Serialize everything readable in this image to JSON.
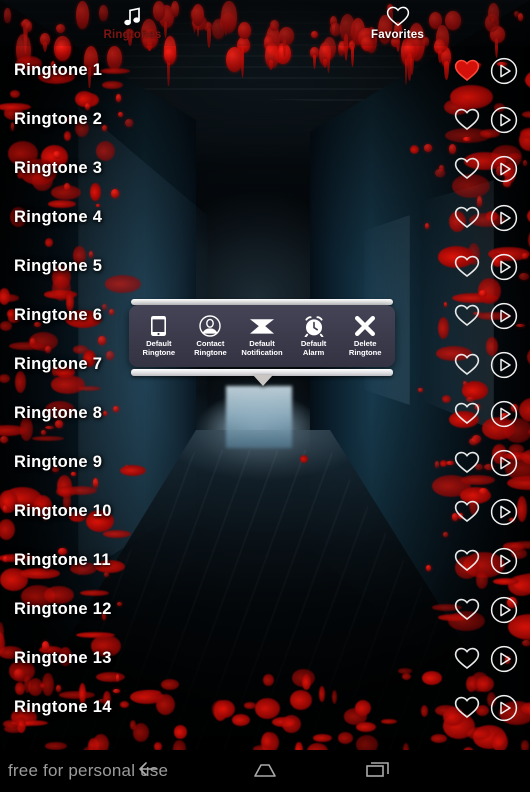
{
  "app": {
    "theme_accent": "#b80c08",
    "popup_bg": "#3b3a4b",
    "text_color": "#ffffff"
  },
  "tabs": [
    {
      "label": "Ringtones",
      "icon": "music-note-icon",
      "state": "inactive"
    },
    {
      "label": "Favorites",
      "icon": "heart-outline-icon",
      "state": "active"
    }
  ],
  "list": {
    "rows": [
      {
        "label": "Ringtone 1",
        "favorite": true,
        "heart_icon": "heart-filled-icon",
        "play_icon": "play-circle-icon"
      },
      {
        "label": "Ringtone 2",
        "favorite": false,
        "heart_icon": "heart-outline-icon",
        "play_icon": "play-circle-icon"
      },
      {
        "label": "Ringtone 3",
        "favorite": false,
        "heart_icon": "heart-outline-icon",
        "play_icon": "play-circle-icon"
      },
      {
        "label": "Ringtone 4",
        "favorite": false,
        "heart_icon": "heart-outline-icon",
        "play_icon": "play-circle-icon"
      },
      {
        "label": "Ringtone 5",
        "favorite": false,
        "heart_icon": "heart-outline-icon",
        "play_icon": "play-circle-icon"
      },
      {
        "label": "Ringtone 6",
        "favorite": false,
        "heart_icon": "heart-outline-icon",
        "play_icon": "play-circle-icon"
      },
      {
        "label": "Ringtone 7",
        "favorite": false,
        "heart_icon": "heart-outline-icon",
        "play_icon": "play-circle-icon"
      },
      {
        "label": "Ringtone 8",
        "favorite": false,
        "heart_icon": "heart-outline-icon",
        "play_icon": "play-circle-icon"
      },
      {
        "label": "Ringtone 9",
        "favorite": false,
        "heart_icon": "heart-outline-icon",
        "play_icon": "play-circle-icon"
      },
      {
        "label": "Ringtone 10",
        "favorite": false,
        "heart_icon": "heart-outline-icon",
        "play_icon": "play-circle-icon"
      },
      {
        "label": "Ringtone 11",
        "favorite": false,
        "heart_icon": "heart-outline-icon",
        "play_icon": "play-circle-icon"
      },
      {
        "label": "Ringtone 12",
        "favorite": false,
        "heart_icon": "heart-outline-icon",
        "play_icon": "play-circle-icon"
      },
      {
        "label": "Ringtone 13",
        "favorite": false,
        "heart_icon": "heart-outline-icon",
        "play_icon": "play-circle-icon"
      },
      {
        "label": "Ringtone 14",
        "favorite": false,
        "heart_icon": "heart-outline-icon",
        "play_icon": "play-circle-icon"
      }
    ]
  },
  "popup": {
    "anchor_row": "Ringtone 7",
    "items": [
      {
        "line1": "Default",
        "line2": "Ringtone",
        "icon": "phone-icon"
      },
      {
        "line1": "Contact",
        "line2": "Ringtone",
        "icon": "contact-icon"
      },
      {
        "line1": "Default",
        "line2": "Notification",
        "icon": "envelope-icon"
      },
      {
        "line1": "Default",
        "line2": "Alarm",
        "icon": "alarm-clock-icon"
      },
      {
        "line1": "Delete",
        "line2": "Ringtone",
        "icon": "close-x-icon"
      }
    ]
  },
  "bottom": {
    "promo_text": "free for personal use",
    "nav": [
      {
        "name": "back",
        "icon": "back-arrow-icon"
      },
      {
        "name": "home",
        "icon": "home-icon"
      },
      {
        "name": "recent",
        "icon": "recents-icon"
      }
    ]
  }
}
